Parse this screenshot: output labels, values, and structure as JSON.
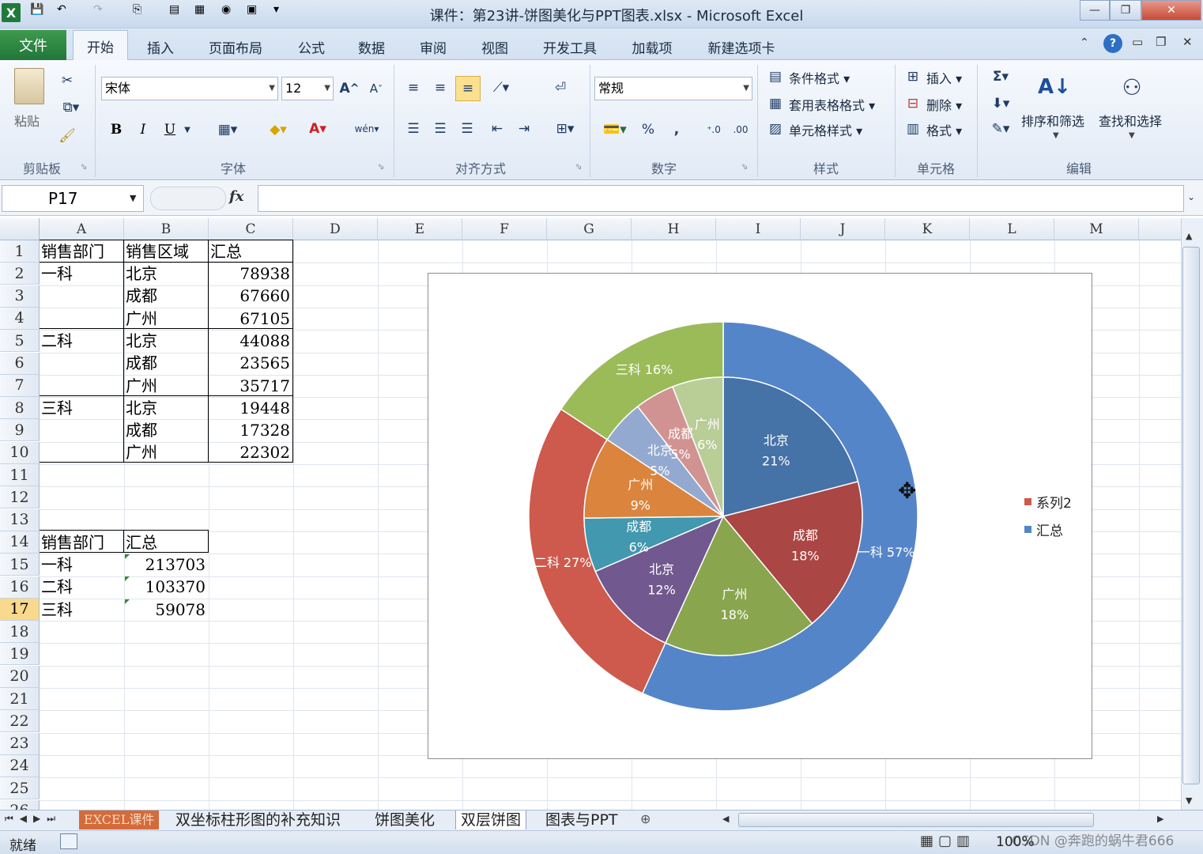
{
  "window": {
    "title": "课件：第23讲-饼图美化与PPT图表.xlsx - Microsoft Excel",
    "app_icon": "X",
    "minimize": "—",
    "restore": "❐",
    "close": "✕"
  },
  "tabs": {
    "file": "文件",
    "items": [
      "开始",
      "插入",
      "页面布局",
      "公式",
      "数据",
      "审阅",
      "视图",
      "开发工具",
      "加载项",
      "新建选项卡"
    ],
    "active": "开始"
  },
  "ribbon": {
    "clipboard": {
      "paste": "粘贴",
      "group": "剪贴板"
    },
    "font": {
      "name": "宋体",
      "size": "12",
      "group": "字体",
      "bold": "B",
      "italic": "I",
      "underline": "U",
      "grow": "A",
      "shrink": "A",
      "font_color_glyph": "A",
      "wen": "wén"
    },
    "alignment": {
      "group": "对齐方式"
    },
    "number": {
      "format": "常规",
      "group": "数字",
      "percent": "%",
      "comma": ","
    },
    "styles": {
      "cond": "条件格式",
      "table": "套用表格格式",
      "cell": "单元格样式",
      "group": "样式"
    },
    "cells": {
      "insert": "插入",
      "delete": "删除",
      "format": "格式",
      "group": "单元格"
    },
    "editing": {
      "sigma": "Σ",
      "sort": "排序和筛选",
      "find": "查找和选择",
      "group": "编辑"
    }
  },
  "formula_bar": {
    "name_box": "P17",
    "fx": "fx",
    "formula": ""
  },
  "grid": {
    "columns": [
      "A",
      "B",
      "C",
      "D",
      "E",
      "F",
      "G",
      "H",
      "I",
      "J",
      "K",
      "L",
      "M"
    ],
    "rows": [
      "1",
      "2",
      "3",
      "4",
      "5",
      "6",
      "7",
      "8",
      "9",
      "10",
      "11",
      "12",
      "13",
      "14",
      "15",
      "16",
      "17",
      "18",
      "19",
      "20",
      "21",
      "22",
      "23",
      "24",
      "25",
      "26"
    ],
    "selected_row": "17",
    "table1": {
      "headers": [
        "销售部门",
        "销售区域",
        "汇总"
      ],
      "depts": [
        "一科",
        "二科",
        "三科"
      ],
      "regions": [
        "北京",
        "成都",
        "广州",
        "北京",
        "成都",
        "广州",
        "北京",
        "成都",
        "广州"
      ],
      "values": [
        "78938",
        "67660",
        "67105",
        "44088",
        "23565",
        "35717",
        "19448",
        "17328",
        "22302"
      ]
    },
    "table2": {
      "headers": [
        "销售部门",
        "汇总"
      ],
      "depts": [
        "一科",
        "二科",
        "三科"
      ],
      "values": [
        "213703",
        "103370",
        "59078"
      ]
    }
  },
  "chart_data": {
    "type": "pie",
    "title": "",
    "series": [
      {
        "name": "汇总",
        "ring": "outer",
        "categories": [
          "一科",
          "二科",
          "三科"
        ],
        "values": [
          213703,
          103370,
          59078
        ],
        "labels": [
          "一科 57%",
          "二科 27%",
          "三科 16%"
        ],
        "colors": [
          "#5585c9",
          "#cd5a4c",
          "#9bbb59"
        ]
      },
      {
        "name": "系列2",
        "ring": "inner",
        "categories": [
          "北京",
          "成都",
          "广州",
          "北京",
          "成都",
          "广州",
          "北京",
          "成都",
          "广州"
        ],
        "values": [
          78938,
          67660,
          67105,
          44088,
          23565,
          35717,
          19448,
          17328,
          22302
        ],
        "labels": [
          "21%",
          "18%",
          "18%",
          "12%",
          "6%",
          "9%",
          "5%",
          "5%",
          "6%"
        ],
        "colors": [
          "#4572a7",
          "#aa4643",
          "#89a54e",
          "#71588f",
          "#4198af",
          "#db843d",
          "#93a9cf",
          "#d19392",
          "#b9cd96"
        ]
      }
    ],
    "legend": {
      "entries": [
        "系列2",
        "汇总"
      ],
      "colors": [
        "#cd5a4c",
        "#5585c9"
      ],
      "position": "right"
    }
  },
  "sheet_tabs": {
    "items": [
      "EXCEL课件",
      "双坐标柱形图的补充知识",
      "饼图美化",
      "双层饼图",
      "图表与PPT"
    ],
    "active": "双层饼图"
  },
  "status": {
    "ready": "就绪",
    "zoom": "100%",
    "watermark": "CSDN @奔跑的蜗牛君666"
  }
}
